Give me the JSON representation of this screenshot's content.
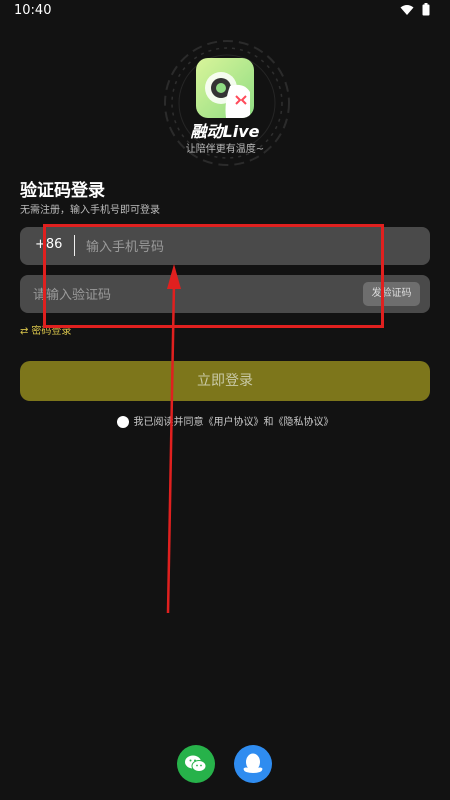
{
  "status_bar": {
    "time": "10:40"
  },
  "branding": {
    "app_name": "融动Live",
    "slogan": "让陪伴更有温度~"
  },
  "login": {
    "title": "验证码登录",
    "subtitle": "无需注册，输入手机号即可登录",
    "country_code": "+86",
    "phone_placeholder": "输入手机号码",
    "code_placeholder": "请输入验证码",
    "send_code_label": "发验证码",
    "password_login_label": "密码登录",
    "login_button_label": "立即登录",
    "agreement_text": "我已阅读并同意《用户协议》和《隐私协议》"
  },
  "social_login": [
    {
      "name": "wechat-icon"
    },
    {
      "name": "qq-icon"
    }
  ],
  "colors": {
    "background": "#121212",
    "input_bg": "#4a4a4a",
    "login_button": "#7d761b",
    "accent": "#d6c24a",
    "annotation": "#e0201f"
  }
}
